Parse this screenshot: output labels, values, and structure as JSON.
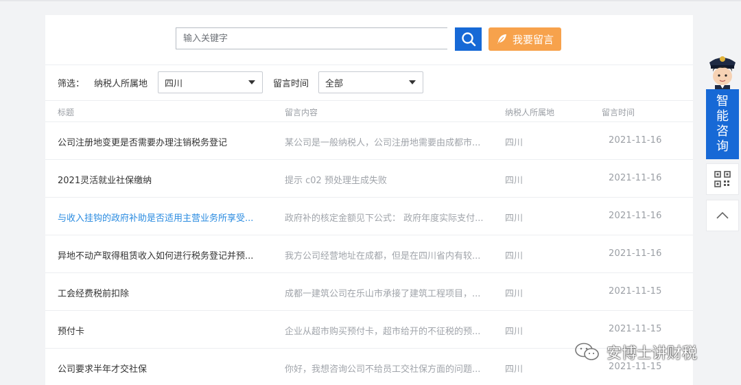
{
  "search": {
    "placeholder": "输入关键字",
    "button_icon": "search-icon",
    "leave_message_label": "我要留言",
    "leave_message_icon": "feather-icon"
  },
  "filters": {
    "label": "筛选：",
    "region_label": "纳税人所属地",
    "region_value": "四川",
    "time_label": "留言时间",
    "time_value": "全部"
  },
  "table": {
    "headers": [
      "标题",
      "留言内容",
      "纳税人所属地",
      "留言时间"
    ],
    "rows": [
      {
        "title": "公司注册地变更是否需要办理注销税务登记",
        "content": "某公司是一般纳税人，公司注册地需要由成都市...",
        "region": "四川",
        "date": "2021-11-16"
      },
      {
        "title": "2021灵活就业社保缴纳",
        "content": "提示 c02 预处理生成失败",
        "region": "四川",
        "date": "2021-11-16"
      },
      {
        "title": "与收入挂钩的政府补助是否适用主营业务所享受...",
        "content": "政府补的核定金额见下公式： 政府年度实际支付...",
        "region": "四川",
        "date": "2021-11-16"
      },
      {
        "title": "异地不动产取得租赁收入如何进行税务登记并预...",
        "content": "我方公司经营地址在成都，但是在四川省内有较...",
        "region": "四川",
        "date": "2021-11-16"
      },
      {
        "title": "工会经费税前扣除",
        "content": "成都一建筑公司在乐山市承接了建筑工程项目，...",
        "region": "四川",
        "date": "2021-11-15"
      },
      {
        "title": "预付卡",
        "content": "企业从超市购买预付卡，超市给开的不征税的预...",
        "region": "四川",
        "date": "2021-11-15"
      },
      {
        "title": "公司要求半年才交社保",
        "content": "你好，我想咨询公司不给员工交社保方面的问题...",
        "region": "四川",
        "date": "2021-11-15"
      }
    ]
  },
  "sidebar": {
    "consult_chars": [
      "智",
      "能",
      "咨",
      "询"
    ],
    "qr_icon": "qr-code-icon",
    "top_icon": "chevron-up-icon"
  },
  "watermark": {
    "text": "安博士讲财税",
    "icon": "wechat-icon"
  },
  "colors": {
    "primary": "#1769d6",
    "accent": "#f7a24c",
    "link": "#2a8be0"
  }
}
